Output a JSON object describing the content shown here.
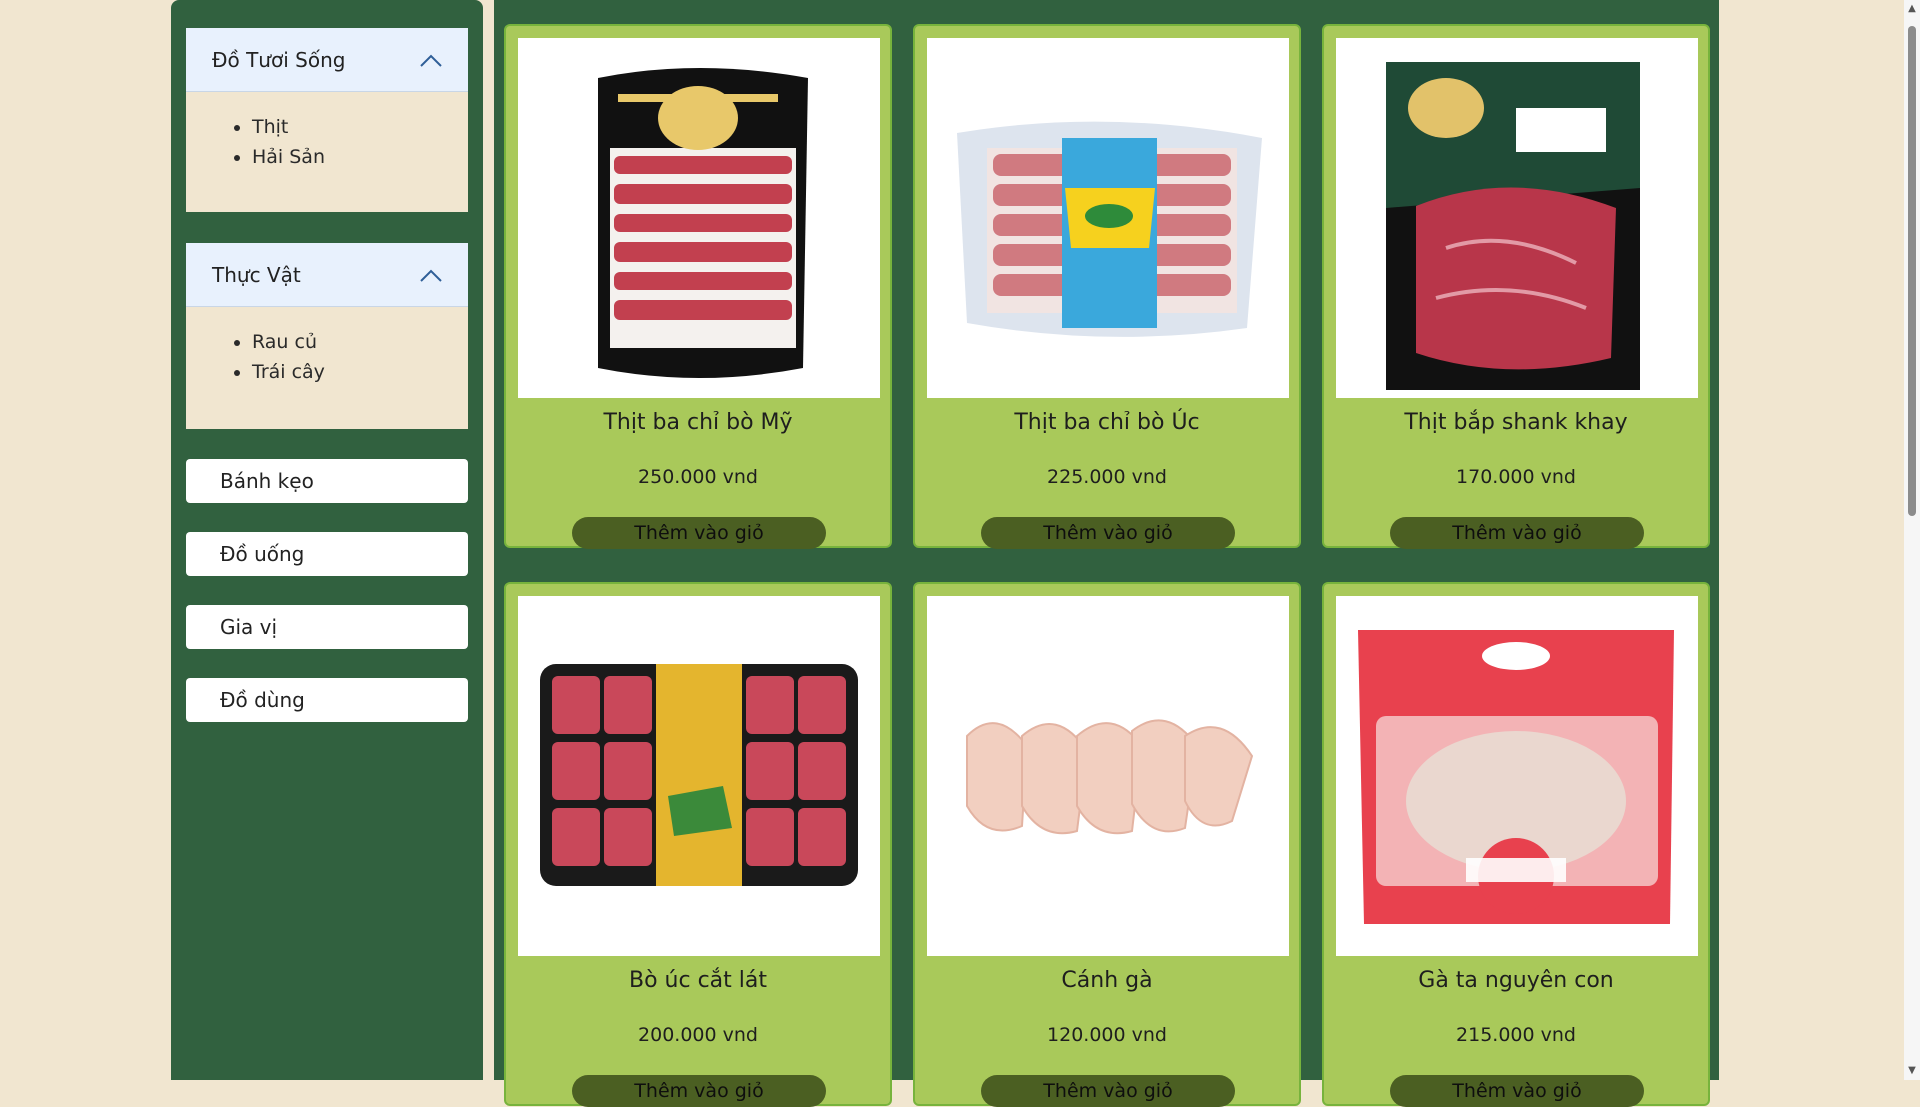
{
  "sidebar": {
    "groups": [
      {
        "title": "Đồ Tươi Sống",
        "items": [
          "Thịt",
          "Hải Sản"
        ]
      },
      {
        "title": "Thực Vật",
        "items": [
          "Rau củ",
          "Trái cây"
        ]
      }
    ],
    "categories": [
      "Bánh kẹo",
      "Đồ uống",
      "Gia vị",
      "Đồ dùng"
    ]
  },
  "products": [
    {
      "name": "Thịt ba chỉ bò Mỹ",
      "price": "250.000 vnd",
      "button": "Thêm vào giỏ"
    },
    {
      "name": "Thịt ba chỉ bò Úc",
      "price": "225.000 vnd",
      "button": "Thêm vào giỏ"
    },
    {
      "name": "Thịt bắp shank khay",
      "price": "170.000 vnd",
      "button": "Thêm vào giỏ"
    },
    {
      "name": "Bò úc cắt lát",
      "price": "200.000 vnd",
      "button": "Thêm vào giỏ"
    },
    {
      "name": "Cánh gà",
      "price": "120.000 vnd",
      "button": "Thêm vào giỏ"
    },
    {
      "name": "Gà ta nguyên con",
      "price": "215.000 vnd",
      "button": "Thêm vào giỏ"
    }
  ],
  "colors": {
    "page_bg": "#f1e6d0",
    "panel_green": "#31613f",
    "card_green": "#a9c95a",
    "button_dark": "#4b5f22"
  }
}
